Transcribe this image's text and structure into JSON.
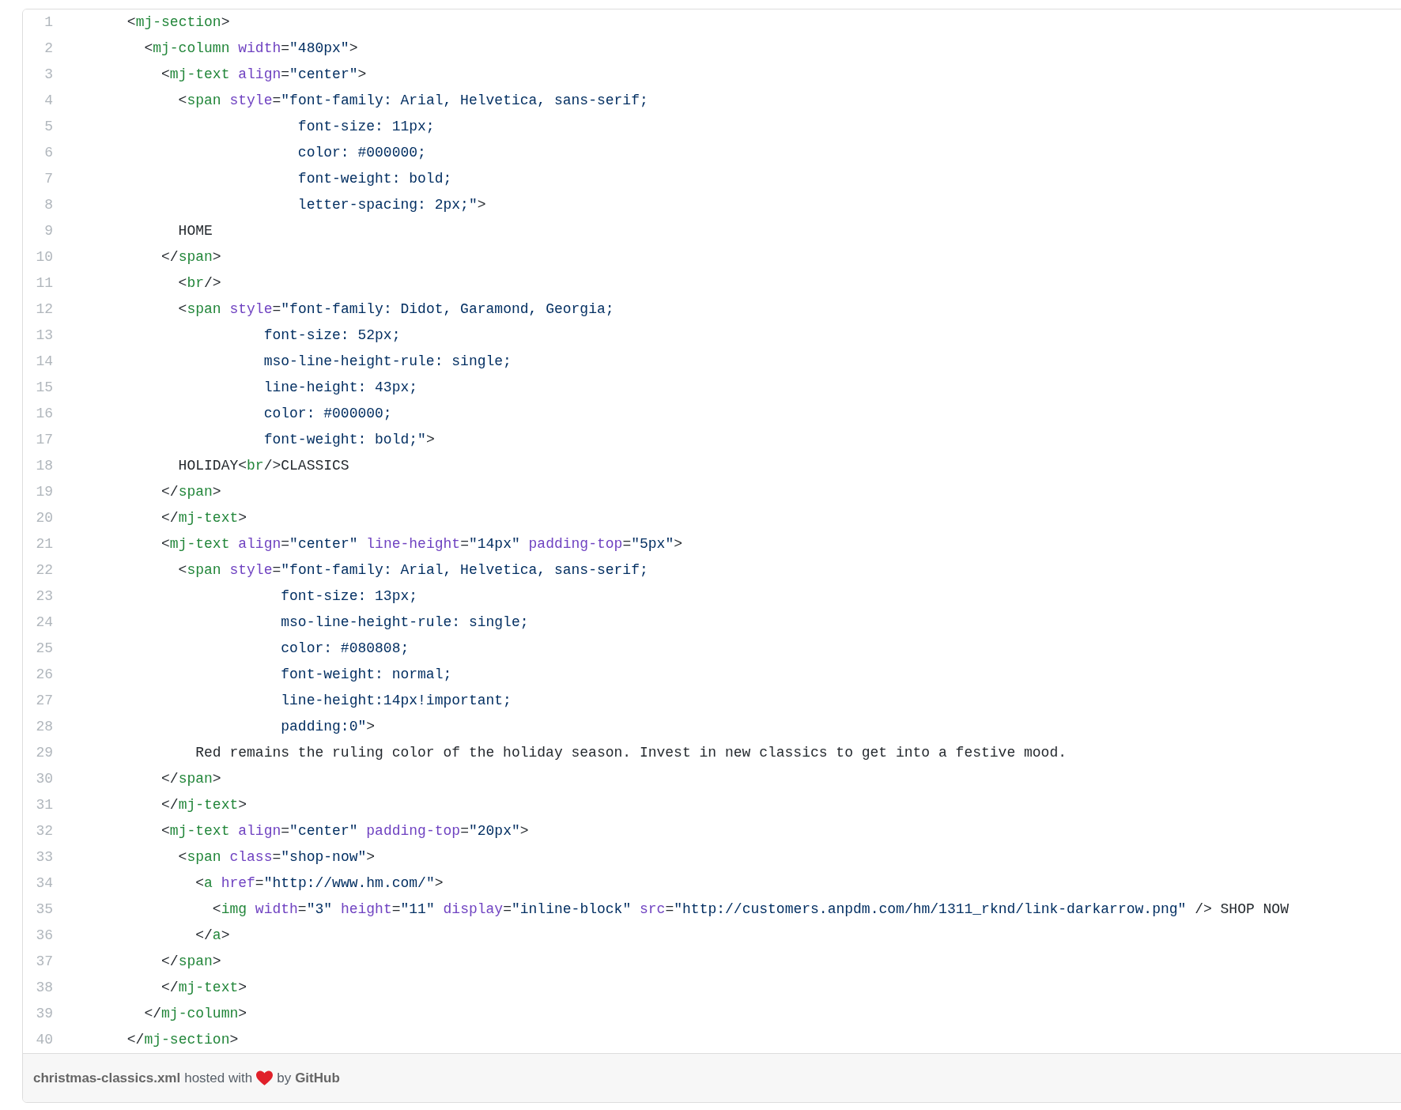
{
  "code_lines": [
    {
      "number": "1",
      "tokens": [
        {
          "kind": "plain",
          "text": "      <"
        },
        {
          "kind": "tag",
          "text": "mj-section"
        },
        {
          "kind": "plain",
          "text": ">"
        }
      ]
    },
    {
      "number": "2",
      "tokens": [
        {
          "kind": "plain",
          "text": "        <"
        },
        {
          "kind": "tag",
          "text": "mj-column"
        },
        {
          "kind": "attr",
          "text": " width"
        },
        {
          "kind": "plain",
          "text": "="
        },
        {
          "kind": "string",
          "text": "\"480px\""
        },
        {
          "kind": "plain",
          "text": ">"
        }
      ]
    },
    {
      "number": "3",
      "tokens": [
        {
          "kind": "plain",
          "text": "          <"
        },
        {
          "kind": "tag",
          "text": "mj-text"
        },
        {
          "kind": "attr",
          "text": " align"
        },
        {
          "kind": "plain",
          "text": "="
        },
        {
          "kind": "string",
          "text": "\"center\""
        },
        {
          "kind": "plain",
          "text": ">"
        }
      ]
    },
    {
      "number": "4",
      "tokens": [
        {
          "kind": "plain",
          "text": "            <"
        },
        {
          "kind": "tag",
          "text": "span"
        },
        {
          "kind": "attr",
          "text": " style"
        },
        {
          "kind": "plain",
          "text": "="
        },
        {
          "kind": "string",
          "text": "\"font-family: Arial, Helvetica, sans-serif;"
        }
      ]
    },
    {
      "number": "5",
      "tokens": [
        {
          "kind": "string",
          "text": "                          font-size: 11px;"
        }
      ]
    },
    {
      "number": "6",
      "tokens": [
        {
          "kind": "string",
          "text": "                          color: #000000;"
        }
      ]
    },
    {
      "number": "7",
      "tokens": [
        {
          "kind": "string",
          "text": "                          font-weight: bold;"
        }
      ]
    },
    {
      "number": "8",
      "tokens": [
        {
          "kind": "string",
          "text": "                          letter-spacing: 2px;\""
        },
        {
          "kind": "plain",
          "text": ">"
        }
      ]
    },
    {
      "number": "9",
      "tokens": [
        {
          "kind": "plain",
          "text": "            HOME"
        }
      ]
    },
    {
      "number": "10",
      "tokens": [
        {
          "kind": "plain",
          "text": "          </"
        },
        {
          "kind": "tag",
          "text": "span"
        },
        {
          "kind": "plain",
          "text": ">"
        }
      ]
    },
    {
      "number": "11",
      "tokens": [
        {
          "kind": "plain",
          "text": "            <"
        },
        {
          "kind": "tag",
          "text": "br"
        },
        {
          "kind": "plain",
          "text": "/>"
        }
      ]
    },
    {
      "number": "12",
      "tokens": [
        {
          "kind": "plain",
          "text": "            <"
        },
        {
          "kind": "tag",
          "text": "span"
        },
        {
          "kind": "attr",
          "text": " style"
        },
        {
          "kind": "plain",
          "text": "="
        },
        {
          "kind": "string",
          "text": "\"font-family: Didot, Garamond, Georgia;"
        }
      ]
    },
    {
      "number": "13",
      "tokens": [
        {
          "kind": "string",
          "text": "                      font-size: 52px;"
        }
      ]
    },
    {
      "number": "14",
      "tokens": [
        {
          "kind": "string",
          "text": "                      mso-line-height-rule: single;"
        }
      ]
    },
    {
      "number": "15",
      "tokens": [
        {
          "kind": "string",
          "text": "                      line-height: 43px;"
        }
      ]
    },
    {
      "number": "16",
      "tokens": [
        {
          "kind": "string",
          "text": "                      color: #000000;"
        }
      ]
    },
    {
      "number": "17",
      "tokens": [
        {
          "kind": "string",
          "text": "                      font-weight: bold;\""
        },
        {
          "kind": "plain",
          "text": ">"
        }
      ]
    },
    {
      "number": "18",
      "tokens": [
        {
          "kind": "plain",
          "text": "            HOLIDAY<"
        },
        {
          "kind": "tag",
          "text": "br"
        },
        {
          "kind": "plain",
          "text": "/>CLASSICS"
        }
      ]
    },
    {
      "number": "19",
      "tokens": [
        {
          "kind": "plain",
          "text": "          </"
        },
        {
          "kind": "tag",
          "text": "span"
        },
        {
          "kind": "plain",
          "text": ">"
        }
      ]
    },
    {
      "number": "20",
      "tokens": [
        {
          "kind": "plain",
          "text": "          </"
        },
        {
          "kind": "tag",
          "text": "mj-text"
        },
        {
          "kind": "plain",
          "text": ">"
        }
      ]
    },
    {
      "number": "21",
      "tokens": [
        {
          "kind": "plain",
          "text": "          <"
        },
        {
          "kind": "tag",
          "text": "mj-text"
        },
        {
          "kind": "attr",
          "text": " align"
        },
        {
          "kind": "plain",
          "text": "="
        },
        {
          "kind": "string",
          "text": "\"center\""
        },
        {
          "kind": "attr",
          "text": " line-height"
        },
        {
          "kind": "plain",
          "text": "="
        },
        {
          "kind": "string",
          "text": "\"14px\""
        },
        {
          "kind": "attr",
          "text": " padding-top"
        },
        {
          "kind": "plain",
          "text": "="
        },
        {
          "kind": "string",
          "text": "\"5px\""
        },
        {
          "kind": "plain",
          "text": ">"
        }
      ]
    },
    {
      "number": "22",
      "tokens": [
        {
          "kind": "plain",
          "text": "            <"
        },
        {
          "kind": "tag",
          "text": "span"
        },
        {
          "kind": "attr",
          "text": " style"
        },
        {
          "kind": "plain",
          "text": "="
        },
        {
          "kind": "string",
          "text": "\"font-family: Arial, Helvetica, sans-serif;"
        }
      ]
    },
    {
      "number": "23",
      "tokens": [
        {
          "kind": "string",
          "text": "                        font-size: 13px;"
        }
      ]
    },
    {
      "number": "24",
      "tokens": [
        {
          "kind": "string",
          "text": "                        mso-line-height-rule: single;"
        }
      ]
    },
    {
      "number": "25",
      "tokens": [
        {
          "kind": "string",
          "text": "                        color: #080808;"
        }
      ]
    },
    {
      "number": "26",
      "tokens": [
        {
          "kind": "string",
          "text": "                        font-weight: normal;"
        }
      ]
    },
    {
      "number": "27",
      "tokens": [
        {
          "kind": "string",
          "text": "                        line-height:14px!important;"
        }
      ]
    },
    {
      "number": "28",
      "tokens": [
        {
          "kind": "string",
          "text": "                        padding:0\""
        },
        {
          "kind": "plain",
          "text": ">"
        }
      ]
    },
    {
      "number": "29",
      "tokens": [
        {
          "kind": "plain",
          "text": "              Red remains the ruling color of the holiday season. Invest in new classics to get into a festive mood."
        }
      ]
    },
    {
      "number": "30",
      "tokens": [
        {
          "kind": "plain",
          "text": "          </"
        },
        {
          "kind": "tag",
          "text": "span"
        },
        {
          "kind": "plain",
          "text": ">"
        }
      ]
    },
    {
      "number": "31",
      "tokens": [
        {
          "kind": "plain",
          "text": "          </"
        },
        {
          "kind": "tag",
          "text": "mj-text"
        },
        {
          "kind": "plain",
          "text": ">"
        }
      ]
    },
    {
      "number": "32",
      "tokens": [
        {
          "kind": "plain",
          "text": "          <"
        },
        {
          "kind": "tag",
          "text": "mj-text"
        },
        {
          "kind": "attr",
          "text": " align"
        },
        {
          "kind": "plain",
          "text": "="
        },
        {
          "kind": "string",
          "text": "\"center\""
        },
        {
          "kind": "attr",
          "text": " padding-top"
        },
        {
          "kind": "plain",
          "text": "="
        },
        {
          "kind": "string",
          "text": "\"20px\""
        },
        {
          "kind": "plain",
          "text": ">"
        }
      ]
    },
    {
      "number": "33",
      "tokens": [
        {
          "kind": "plain",
          "text": "            <"
        },
        {
          "kind": "tag",
          "text": "span"
        },
        {
          "kind": "attr",
          "text": " class"
        },
        {
          "kind": "plain",
          "text": "="
        },
        {
          "kind": "string",
          "text": "\"shop-now\""
        },
        {
          "kind": "plain",
          "text": ">"
        }
      ]
    },
    {
      "number": "34",
      "tokens": [
        {
          "kind": "plain",
          "text": "              <"
        },
        {
          "kind": "tag",
          "text": "a"
        },
        {
          "kind": "attr",
          "text": " href"
        },
        {
          "kind": "plain",
          "text": "="
        },
        {
          "kind": "string",
          "text": "\"http://www.hm.com/\""
        },
        {
          "kind": "plain",
          "text": ">"
        }
      ]
    },
    {
      "number": "35",
      "tokens": [
        {
          "kind": "plain",
          "text": "                <"
        },
        {
          "kind": "tag",
          "text": "img"
        },
        {
          "kind": "attr",
          "text": " width"
        },
        {
          "kind": "plain",
          "text": "="
        },
        {
          "kind": "string",
          "text": "\"3\""
        },
        {
          "kind": "attr",
          "text": " height"
        },
        {
          "kind": "plain",
          "text": "="
        },
        {
          "kind": "string",
          "text": "\"11\""
        },
        {
          "kind": "attr",
          "text": " display"
        },
        {
          "kind": "plain",
          "text": "="
        },
        {
          "kind": "string",
          "text": "\"inline-block\""
        },
        {
          "kind": "attr",
          "text": " src"
        },
        {
          "kind": "plain",
          "text": "="
        },
        {
          "kind": "string",
          "text": "\"http://customers.anpdm.com/hm/1311_rknd/link-darkarrow.png\""
        },
        {
          "kind": "plain",
          "text": " /> SHOP NOW"
        }
      ]
    },
    {
      "number": "36",
      "tokens": [
        {
          "kind": "plain",
          "text": "              </"
        },
        {
          "kind": "tag",
          "text": "a"
        },
        {
          "kind": "plain",
          "text": ">"
        }
      ]
    },
    {
      "number": "37",
      "tokens": [
        {
          "kind": "plain",
          "text": "          </"
        },
        {
          "kind": "tag",
          "text": "span"
        },
        {
          "kind": "plain",
          "text": ">"
        }
      ]
    },
    {
      "number": "38",
      "tokens": [
        {
          "kind": "plain",
          "text": "          </"
        },
        {
          "kind": "tag",
          "text": "mj-text"
        },
        {
          "kind": "plain",
          "text": ">"
        }
      ]
    },
    {
      "number": "39",
      "tokens": [
        {
          "kind": "plain",
          "text": "        </"
        },
        {
          "kind": "tag",
          "text": "mj-column"
        },
        {
          "kind": "plain",
          "text": ">"
        }
      ]
    },
    {
      "number": "40",
      "tokens": [
        {
          "kind": "plain",
          "text": "      </"
        },
        {
          "kind": "tag",
          "text": "mj-section"
        },
        {
          "kind": "plain",
          "text": ">"
        }
      ]
    }
  ],
  "footer": {
    "filename": "christmas-classics.xml",
    "hosted_text": "hosted with",
    "by_text": "by",
    "brand": "GitHub"
  }
}
